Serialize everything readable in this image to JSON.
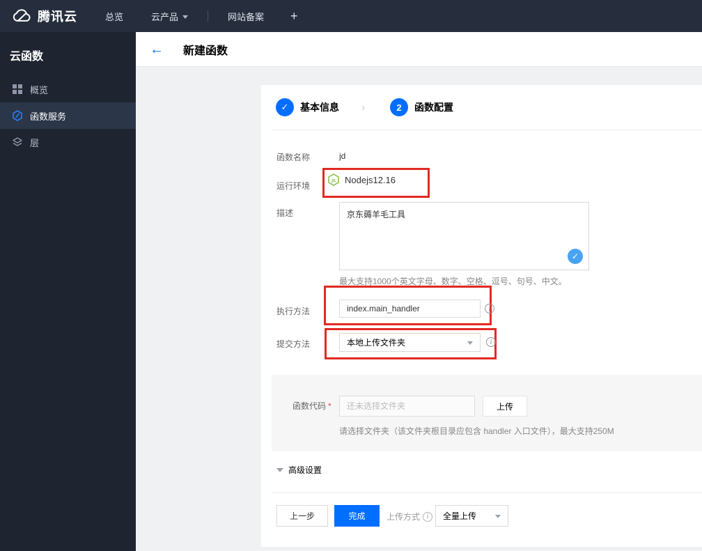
{
  "colors": {
    "navbar_bg": "#262e3d",
    "sidebar_bg": "#1e2430",
    "sidebar_active_bg": "#2b3648",
    "accent_blue": "#006eff",
    "check_blue": "#4aa3f2",
    "highlight_red": "#e12a22",
    "node_green": "#83c141"
  },
  "navbar": {
    "brand": "腾讯云",
    "items": [
      {
        "label": "总览"
      },
      {
        "label": "云产品"
      },
      {
        "label": "网站备案"
      },
      {
        "label": "+"
      }
    ]
  },
  "sidebar": {
    "title": "云函数",
    "items": [
      {
        "label": "概览"
      },
      {
        "label": "函数服务"
      },
      {
        "label": "层"
      }
    ]
  },
  "header": {
    "back": "←",
    "title": "新建函数"
  },
  "steps": {
    "step1": {
      "label": "基本信息",
      "mark": "✓"
    },
    "separator": "›",
    "step2": {
      "num": "2",
      "label": "函数配置"
    }
  },
  "form": {
    "name": {
      "label": "函数名称",
      "value": "jd"
    },
    "runtime": {
      "label": "运行环境",
      "value": "Nodejs12.16",
      "icon_text": "js"
    },
    "desc": {
      "label": "描述",
      "value": "京东薅羊毛工具",
      "check_mark": "✓",
      "hint": "最大支持1000个英文字母、数字、空格、逗号、句号、中文。"
    },
    "handler": {
      "label": "执行方法",
      "value": "index.main_handler",
      "info": "i"
    },
    "submit": {
      "label": "提交方法",
      "value": "本地上传文件夹",
      "info": "i"
    },
    "code": {
      "label": "函数代码",
      "required_mark": "*",
      "placeholder": "还未选择文件夹",
      "upload_button": "上传",
      "hint": "请选择文件夹（该文件夹根目录应包含 handler 入口文件），最大支持250M"
    },
    "advanced": {
      "label": "高级设置"
    }
  },
  "footer": {
    "prev": "上一步",
    "finish": "完成",
    "upload_mode_label": "上传方式",
    "upload_mode_info": "i",
    "upload_mode_value": "全量上传"
  }
}
